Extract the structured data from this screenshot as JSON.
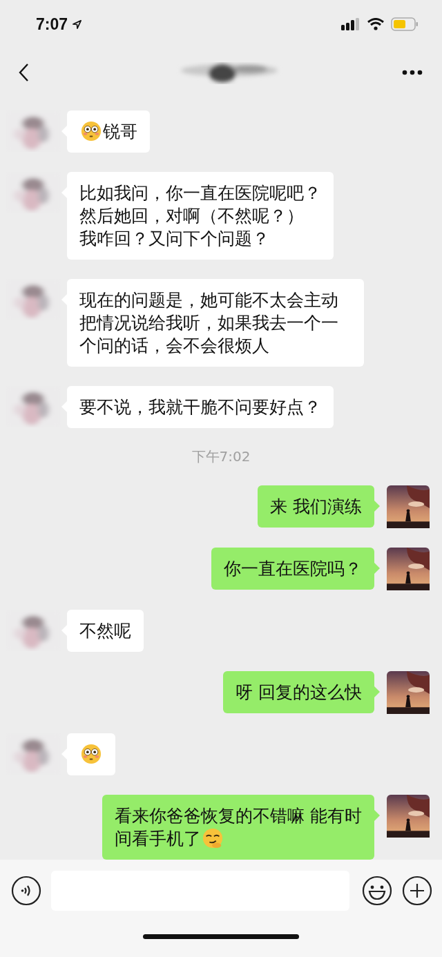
{
  "status_bar": {
    "time": "7:07"
  },
  "messages": [
    {
      "kind": "text",
      "outgoing": false,
      "parts": [
        {
          "kind": "flushed"
        },
        {
          "kind": "text",
          "text": "锐哥"
        }
      ]
    },
    {
      "kind": "text",
      "outgoing": false,
      "parts": [
        {
          "kind": "line",
          "text": "比如我问，你一直在医院呢吧？"
        },
        {
          "kind": "line",
          "text": "然后她回，对啊（不然呢？）"
        },
        {
          "kind": "line",
          "text": "我咋回？又问下个问题？"
        }
      ]
    },
    {
      "kind": "text",
      "outgoing": false,
      "parts": [
        {
          "kind": "text",
          "text": "现在的问题是，她可能不太会主动把情况说给我听，如果我去一个一个问的话，会不会很烦人"
        }
      ]
    },
    {
      "kind": "text",
      "outgoing": false,
      "parts": [
        {
          "kind": "text",
          "text": "要不说，我就干脆不问要好点？"
        }
      ]
    },
    {
      "kind": "time",
      "text": "下午7:02"
    },
    {
      "kind": "text",
      "outgoing": true,
      "parts": [
        {
          "kind": "text",
          "text": "来 我们演练"
        }
      ]
    },
    {
      "kind": "text",
      "outgoing": true,
      "parts": [
        {
          "kind": "text",
          "text": "你一直在医院吗？"
        }
      ]
    },
    {
      "kind": "text",
      "outgoing": false,
      "parts": [
        {
          "kind": "text",
          "text": "不然呢"
        }
      ]
    },
    {
      "kind": "text",
      "outgoing": true,
      "parts": [
        {
          "kind": "text",
          "text": "呀 回复的这么快"
        }
      ]
    },
    {
      "kind": "text",
      "outgoing": false,
      "parts": [
        {
          "kind": "flushed"
        }
      ]
    },
    {
      "kind": "text",
      "outgoing": true,
      "parts": [
        {
          "kind": "line",
          "text": "看来你爸爸恢复的不错嘛 能有时"
        },
        {
          "kind": "text",
          "text": "间看手机了"
        },
        {
          "kind": "smirk"
        }
      ]
    }
  ]
}
